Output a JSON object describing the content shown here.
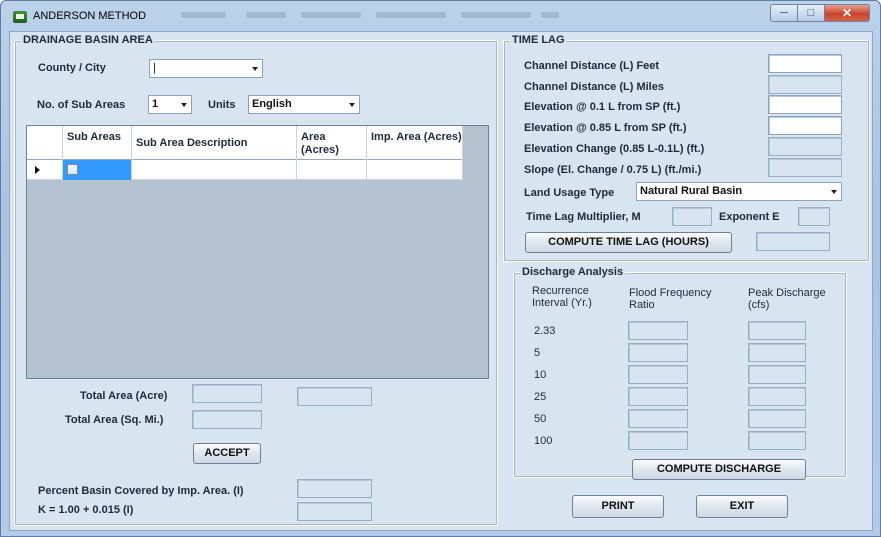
{
  "window": {
    "title": "ANDERSON METHOD"
  },
  "drainage": {
    "group_title": "DRAINAGE BASIN AREA",
    "county_label": "County / City",
    "county_value": "|",
    "subareas_label": "No. of Sub Areas",
    "subareas_value": "1",
    "units_label": "Units",
    "units_value": "English",
    "grid": {
      "columns": [
        "Sub Areas",
        "Sub Area Description",
        "Area (Acres)",
        "Imp. Area (Acres)"
      ]
    },
    "total_area_acre_label": "Total Area (Acre)",
    "total_area_sqmi_label": "Total Area (Sq. Mi.)",
    "accept_label": "ACCEPT",
    "percent_label": "Percent Basin Covered by Imp. Area. (I)",
    "k_label": "K = 1.00 + 0.015 (I)"
  },
  "timelag": {
    "group_title": "TIME LAG",
    "fields": [
      "Channel Distance (L) Feet",
      "Channel Distance (L) Miles",
      "Elevation @ 0.1 L from SP (ft.)",
      "Elevation @ 0.85 L from SP (ft.)",
      "Elevation Change (0.85 L-0.1L) (ft.)",
      "Slope (El. Change / 0.75 L) (ft./mi.)"
    ],
    "land_usage_label": "Land Usage Type",
    "land_usage_value": "Natural Rural Basin",
    "multiplier_label": "Time Lag Multiplier, M",
    "exponent_label": "Exponent E",
    "compute_label": "COMPUTE TIME LAG (HOURS)"
  },
  "discharge": {
    "group_title": "Discharge Analysis",
    "col_recurrence": "Recurrence Interval (Yr.)",
    "col_ratio": "Flood Frequency Ratio",
    "col_peak": "Peak Discharge (cfs)",
    "intervals": [
      "2.33",
      "5",
      "10",
      "25",
      "50",
      "100"
    ],
    "compute_label": "COMPUTE DISCHARGE"
  },
  "footer": {
    "print_label": "PRINT",
    "exit_label": "EXIT"
  }
}
